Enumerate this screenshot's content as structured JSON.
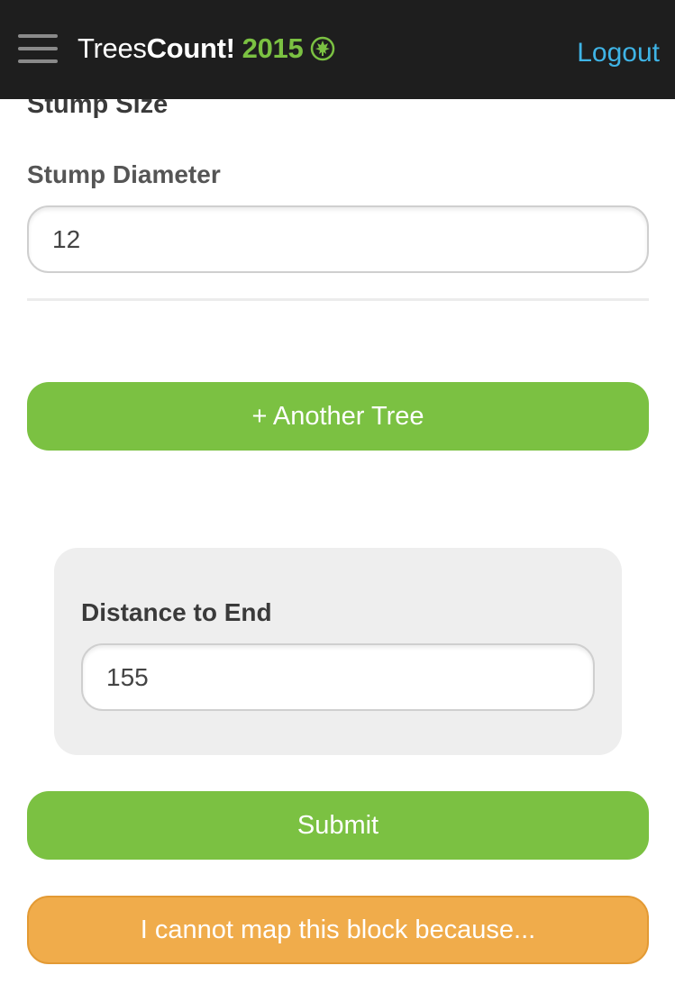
{
  "header": {
    "brand_light": "Trees",
    "brand_bold": "Count!",
    "brand_year": "2015",
    "logout_label": "Logout",
    "icons": [
      "hamburger-menu-icon",
      "leaf-icon"
    ]
  },
  "colors": {
    "header_bg": "#1e1e1e",
    "accent_green": "#7bc142",
    "link_blue": "#3fb4e6",
    "warning_orange": "#f0ac4b",
    "panel_bg": "#eeeeee"
  },
  "stump": {
    "section_title": "Stump Size",
    "diameter_label": "Stump Diameter",
    "diameter_value": "12"
  },
  "actions": {
    "another_tree_label": "+ Another Tree",
    "submit_label": "Submit",
    "cannot_map_label": "I cannot map this block because..."
  },
  "distance": {
    "label": "Distance to End",
    "value": "155"
  }
}
